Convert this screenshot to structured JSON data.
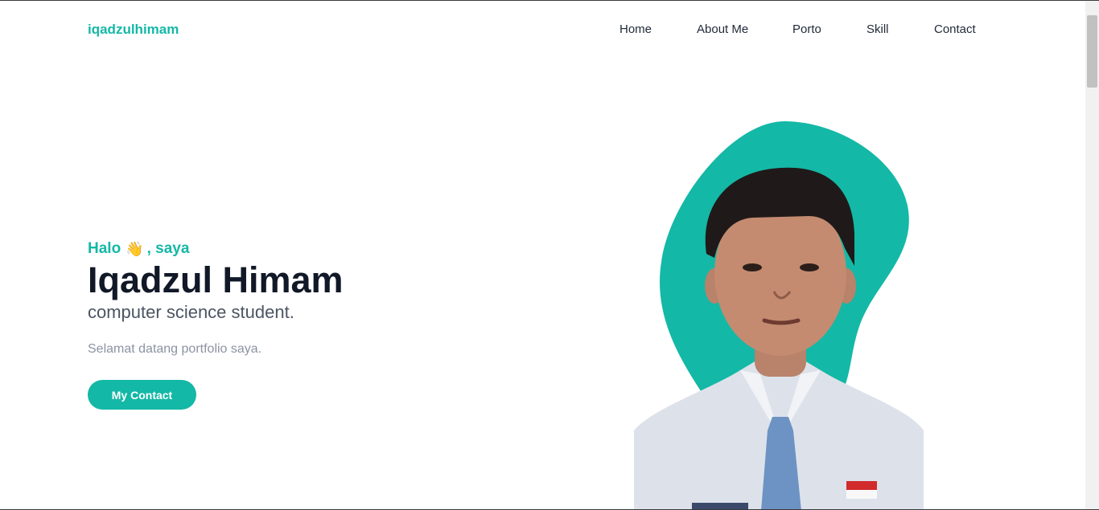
{
  "brand": {
    "logo_text": "iqadzulhimam",
    "accent_color": "#14b8a6"
  },
  "nav": {
    "items": [
      {
        "label": "Home"
      },
      {
        "label": "About Me"
      },
      {
        "label": "Porto"
      },
      {
        "label": "Skill"
      },
      {
        "label": "Contact"
      }
    ]
  },
  "hero": {
    "greeting_prefix": "Halo",
    "greeting_icon": "waving-hand-icon",
    "greeting_suffix": ", saya",
    "name": "Iqadzul Himam",
    "role": "computer science student.",
    "welcome": "Selamat datang portfolio saya.",
    "cta_label": "My Contact"
  },
  "portrait": {
    "icon": "profile-photo"
  }
}
